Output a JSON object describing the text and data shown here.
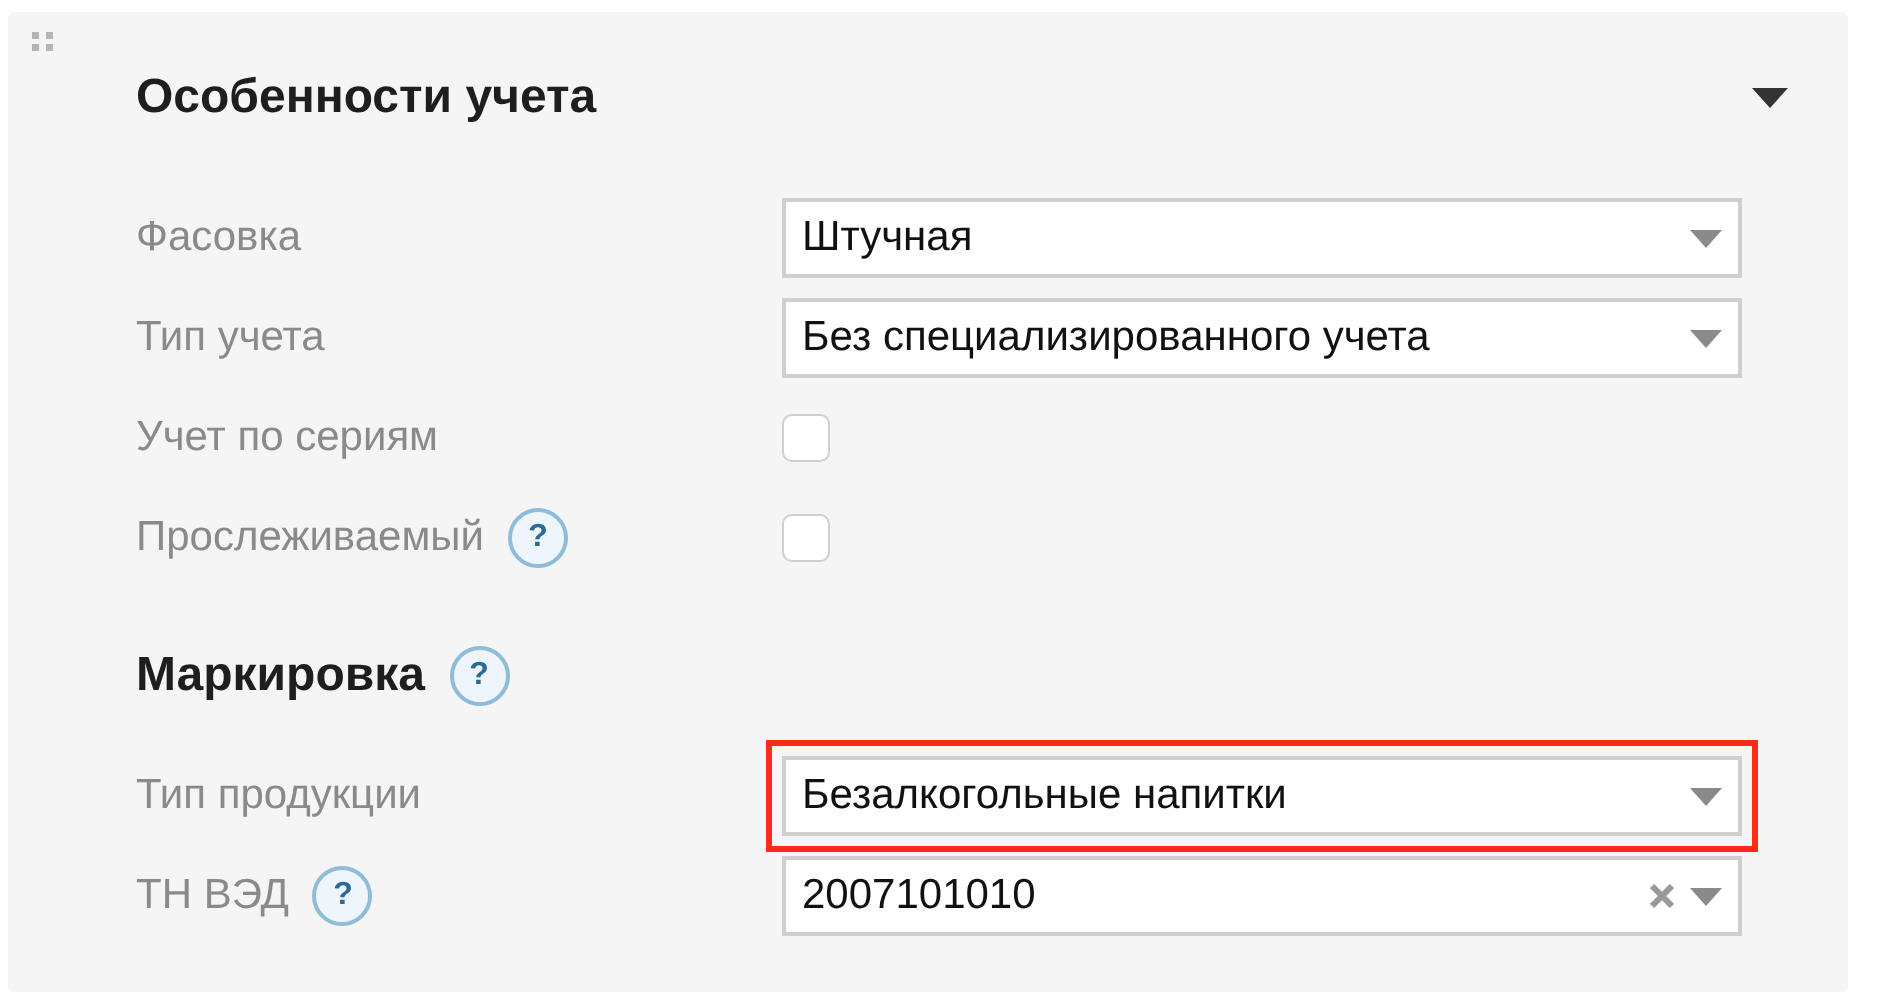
{
  "sections": [
    {
      "title": "Особенности учета",
      "collapsible": true,
      "fields": [
        {
          "label": "Фасовка",
          "kind": "select",
          "value": "Штучная",
          "clearable": false,
          "highlighted": false
        },
        {
          "label": "Тип учета",
          "kind": "select",
          "value": "Без специализированного учета",
          "clearable": false,
          "highlighted": false
        },
        {
          "label": "Учет по сериям",
          "kind": "checkbox",
          "checked": false
        },
        {
          "label": "Прослеживаемый",
          "help": "?",
          "kind": "checkbox",
          "checked": false
        }
      ]
    },
    {
      "title": "Маркировка",
      "help": "?",
      "collapsible": false,
      "fields": [
        {
          "label": "Тип продукции",
          "kind": "select",
          "value": "Безалкогольные напитки",
          "clearable": false,
          "highlighted": true
        },
        {
          "label": "ТН ВЭД",
          "help": "?",
          "kind": "select",
          "value": "2007101010",
          "clearable": true,
          "highlighted": false
        }
      ]
    }
  ]
}
